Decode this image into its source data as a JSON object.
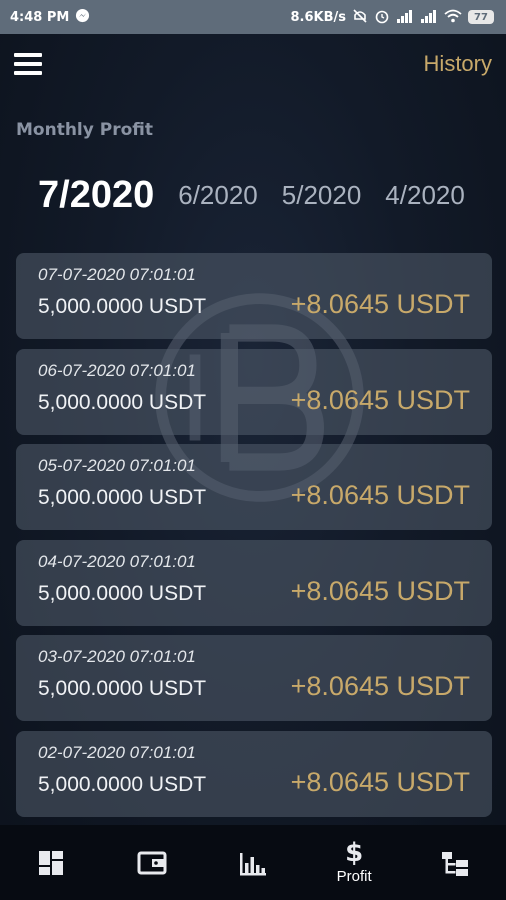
{
  "status_bar": {
    "time": "4:48 PM",
    "network_speed": "8.6KB/s",
    "battery": "77",
    "icons": [
      "messenger-icon",
      "mute-icon",
      "alarm-icon",
      "signal-icon",
      "signal-icon",
      "wifi-icon",
      "battery-icon"
    ]
  },
  "header": {
    "menu_icon": "hamburger-menu-icon",
    "history_label": "History"
  },
  "section_title": "Monthly Profit",
  "month_tabs": [
    {
      "label": "7/2020",
      "active": true
    },
    {
      "label": "6/2020",
      "active": false
    },
    {
      "label": "5/2020",
      "active": false
    },
    {
      "label": "4/2020",
      "active": false
    }
  ],
  "records": [
    {
      "datetime": "07-07-2020 07:01:01",
      "amount": "5,000.0000 USDT",
      "profit": "+8.0645 USDT"
    },
    {
      "datetime": "06-07-2020 07:01:01",
      "amount": "5,000.0000 USDT",
      "profit": "+8.0645 USDT"
    },
    {
      "datetime": "05-07-2020 07:01:01",
      "amount": "5,000.0000 USDT",
      "profit": "+8.0645 USDT"
    },
    {
      "datetime": "04-07-2020 07:01:01",
      "amount": "5,000.0000 USDT",
      "profit": "+8.0645 USDT"
    },
    {
      "datetime": "03-07-2020 07:01:01",
      "amount": "5,000.0000 USDT",
      "profit": "+8.0645 USDT"
    },
    {
      "datetime": "02-07-2020 07:01:01",
      "amount": "5,000.0000 USDT",
      "profit": "+8.0645 USDT"
    }
  ],
  "bottom_nav": [
    {
      "icon": "dashboard-icon",
      "label": ""
    },
    {
      "icon": "wallet-icon",
      "label": ""
    },
    {
      "icon": "bar-chart-icon",
      "label": ""
    },
    {
      "icon": "dollar-icon",
      "label": "Profit",
      "active": true
    },
    {
      "icon": "hierarchy-icon",
      "label": ""
    }
  ],
  "colors": {
    "accent_gold": "#c8a96a",
    "background": "#121a28",
    "card": "#4a5262",
    "status_bar": "#5f6c7a"
  }
}
